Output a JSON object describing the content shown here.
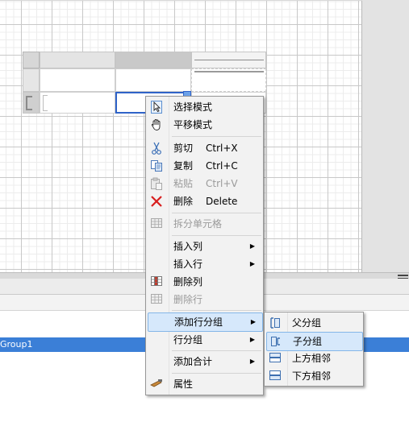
{
  "context_menu": {
    "items": [
      {
        "label": "选择模式",
        "icon": "select-mode-icon"
      },
      {
        "label": "平移模式",
        "icon": "hand-pan-icon"
      },
      {
        "label": "剪切",
        "shortcut": "Ctrl+X",
        "icon": "scissors-icon"
      },
      {
        "label": "复制",
        "shortcut": "Ctrl+C",
        "icon": "copy-icon"
      },
      {
        "label": "粘贴",
        "shortcut": "Ctrl+V",
        "icon": "paste-icon",
        "disabled": true
      },
      {
        "label": "删除",
        "shortcut": "Delete",
        "icon": "delete-x-icon"
      },
      {
        "label": "拆分单元格",
        "icon": "split-cells-icon",
        "disabled": true
      },
      {
        "label": "插入列",
        "submenu": true
      },
      {
        "label": "插入行",
        "submenu": true
      },
      {
        "label": "删除列",
        "icon": "delete-column-icon"
      },
      {
        "label": "删除行",
        "icon": "delete-row-icon",
        "disabled": true
      },
      {
        "label": "添加行分组",
        "submenu": true,
        "highlighted": true
      },
      {
        "label": "行分组",
        "submenu": true
      },
      {
        "label": "添加合计",
        "submenu": true
      },
      {
        "label": "属性",
        "icon": "properties-icon"
      }
    ],
    "arrow": "▶"
  },
  "submenu": {
    "items": [
      {
        "label": "父分组",
        "icon": "parent-group-icon"
      },
      {
        "label": "子分组",
        "icon": "child-group-icon",
        "highlighted": true
      },
      {
        "label": "上方相邻",
        "icon": "adjacent-above-icon"
      },
      {
        "label": "下方相邻",
        "icon": "adjacent-below-icon"
      }
    ]
  },
  "row_groups": {
    "selected_group": "Group1"
  },
  "colors": {
    "accent": "#3b7fd7",
    "selection_border": "#2f63c8",
    "menu_highlight": "#d6e8fb",
    "delete_red": "#d81e1e"
  }
}
